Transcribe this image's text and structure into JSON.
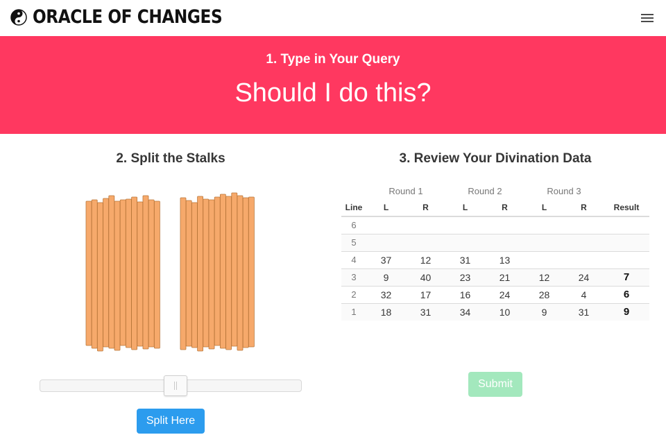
{
  "brand": {
    "title": "ORACLE OF CHANGES",
    "icon": "yin-yang-icon"
  },
  "navbar": {
    "menu_icon": "hamburger-menu-icon"
  },
  "hero": {
    "step_label": "1. Type in Your Query",
    "query": "Should I do this?"
  },
  "stalks_section": {
    "title": "2. Split the Stalks",
    "left_count": 13,
    "right_count": 13,
    "stalk_color": "#f6a96b",
    "stalk_border_color": "#b9773b",
    "split_button_label": "Split Here",
    "slider_value": 0.5
  },
  "divination": {
    "title": "3. Review Your Divination Data",
    "round_headers": [
      "Round 1",
      "Round 2",
      "Round 3"
    ],
    "column_headers": [
      "Line",
      "L",
      "R",
      "L",
      "R",
      "L",
      "R",
      "Result"
    ],
    "rows": [
      {
        "line": "6",
        "r1l": "",
        "r1r": "",
        "r2l": "",
        "r2r": "",
        "r3l": "",
        "r3r": "",
        "result": ""
      },
      {
        "line": "5",
        "r1l": "",
        "r1r": "",
        "r2l": "",
        "r2r": "",
        "r3l": "",
        "r3r": "",
        "result": ""
      },
      {
        "line": "4",
        "r1l": "37",
        "r1r": "12",
        "r2l": "31",
        "r2r": "13",
        "r3l": "",
        "r3r": "",
        "result": ""
      },
      {
        "line": "3",
        "r1l": "9",
        "r1r": "40",
        "r2l": "23",
        "r2r": "21",
        "r3l": "12",
        "r3r": "24",
        "result": "7"
      },
      {
        "line": "2",
        "r1l": "32",
        "r1r": "17",
        "r2l": "16",
        "r2r": "24",
        "r3l": "28",
        "r3r": "4",
        "result": "6"
      },
      {
        "line": "1",
        "r1l": "18",
        "r1r": "31",
        "r2l": "34",
        "r2r": "10",
        "r3l": "9",
        "r3r": "31",
        "result": "9"
      }
    ],
    "submit_label": "Submit"
  },
  "colors": {
    "hero_bg": "#ff3860",
    "split_button": "#2c9cee",
    "submit_button_disabled": "#a3e8bd"
  }
}
